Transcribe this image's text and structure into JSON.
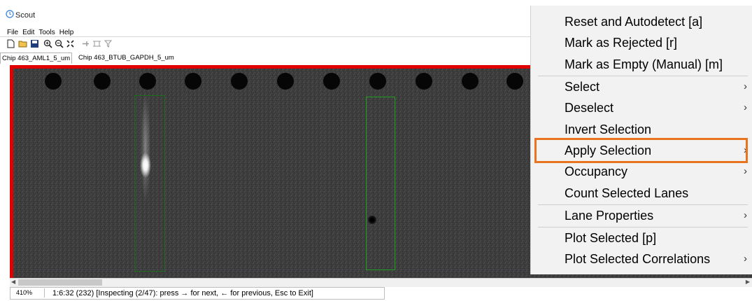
{
  "window": {
    "title": "Scout",
    "menu": [
      "File",
      "Edit",
      "Tools",
      "Help"
    ],
    "toolbar_icons": [
      "new-file-icon",
      "open-folder-icon",
      "save-icon",
      "zoom-in-icon",
      "zoom-out-icon",
      "fit-icon",
      "pin-icon",
      "frame-icon",
      "filter-icon"
    ],
    "tabs": [
      {
        "label": "Chip 463_AML1_5_um",
        "active": true
      },
      {
        "label": "Chip 463_BTUB_GAPDH_5_um",
        "active": false
      }
    ]
  },
  "status": {
    "zoom": "410%",
    "message": "1:6:32 (232) [Inspecting (2/47): press → for next, ← for previous, Esc to Exit]"
  },
  "context_menu": {
    "items": [
      {
        "label": "Reset and Autodetect [a]",
        "submenu": false
      },
      {
        "label": "Mark as Rejected [r]",
        "submenu": false
      },
      {
        "label": "Mark as Empty (Manual) [m]",
        "submenu": false
      },
      {
        "label": "Select",
        "submenu": true
      },
      {
        "label": "Deselect",
        "submenu": true
      },
      {
        "label": "Invert Selection",
        "submenu": false
      },
      {
        "label": "Apply Selection",
        "submenu": true,
        "highlighted": true
      },
      {
        "label": "Occupancy",
        "submenu": true
      },
      {
        "label": "Count Selected Lanes",
        "submenu": false
      },
      {
        "label": "Lane Properties",
        "submenu": true
      },
      {
        "label": "Plot Selected [p]",
        "submenu": false
      },
      {
        "label": "Plot Selected Correlations",
        "submenu": true
      }
    ]
  },
  "colors": {
    "selection_border": "#e00000",
    "lane_box": "#1fa01f",
    "highlight": "#e8741f"
  }
}
